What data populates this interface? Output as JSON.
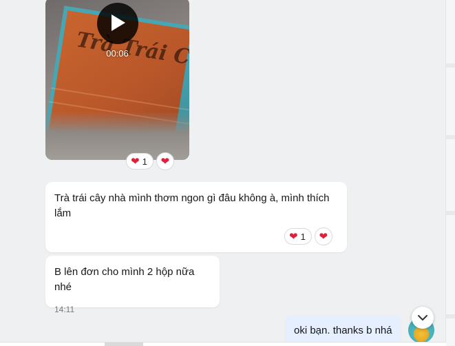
{
  "video": {
    "duration": "00:06",
    "box_brand_text": "Trà Trái Cây",
    "reactions": {
      "count": "1",
      "heart": "❤",
      "react_heart": "❤"
    }
  },
  "messages": [
    {
      "text": "Trà trái cây nhà mình thơm ngon gì đâu không à, mình thích lắm",
      "reactions": {
        "count": "1",
        "heart": "❤",
        "react_heart": "❤"
      }
    },
    {
      "text": "B lên đơn cho mình 2 hộp nữa nhé",
      "time": "14:11"
    },
    {
      "text": "oki bạn. thanks b nhá"
    }
  ],
  "colors": {
    "chat_background": "#eef0f1",
    "incoming_bubble": "#ffffff",
    "outgoing_bubble": "#e5efff",
    "heart": "#e0203a"
  },
  "icons": {
    "play": "play-icon",
    "heart": "heart-icon",
    "scroll_down": "chevron-down-icon"
  }
}
